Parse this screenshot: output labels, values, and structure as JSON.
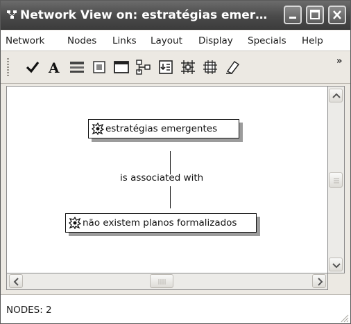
{
  "window": {
    "title": "Network View on: estratégias emer…"
  },
  "menu": [
    {
      "label": "Network"
    },
    {
      "label": "Nodes"
    },
    {
      "label": "Links"
    },
    {
      "label": "Layout"
    },
    {
      "label": "Display"
    },
    {
      "label": "Specials"
    },
    {
      "label": "Help"
    }
  ],
  "toolbar": {
    "tools": [
      {
        "icon": "checkmark-icon"
      },
      {
        "icon": "font-icon"
      },
      {
        "icon": "line-style-icon"
      },
      {
        "icon": "node-fill-icon"
      },
      {
        "icon": "window-frame-icon"
      },
      {
        "icon": "layout-tree-icon"
      },
      {
        "icon": "import-node-icon"
      },
      {
        "icon": "network-icon"
      },
      {
        "icon": "network-select-icon"
      },
      {
        "icon": "eraser-icon"
      }
    ],
    "overflow": "»"
  },
  "graph": {
    "nodes": [
      {
        "label": "estratégias emergentes"
      },
      {
        "label": "não existem planos formalizados"
      }
    ],
    "link": {
      "label": "is associated with"
    }
  },
  "status": {
    "text": "NODES: 2"
  }
}
